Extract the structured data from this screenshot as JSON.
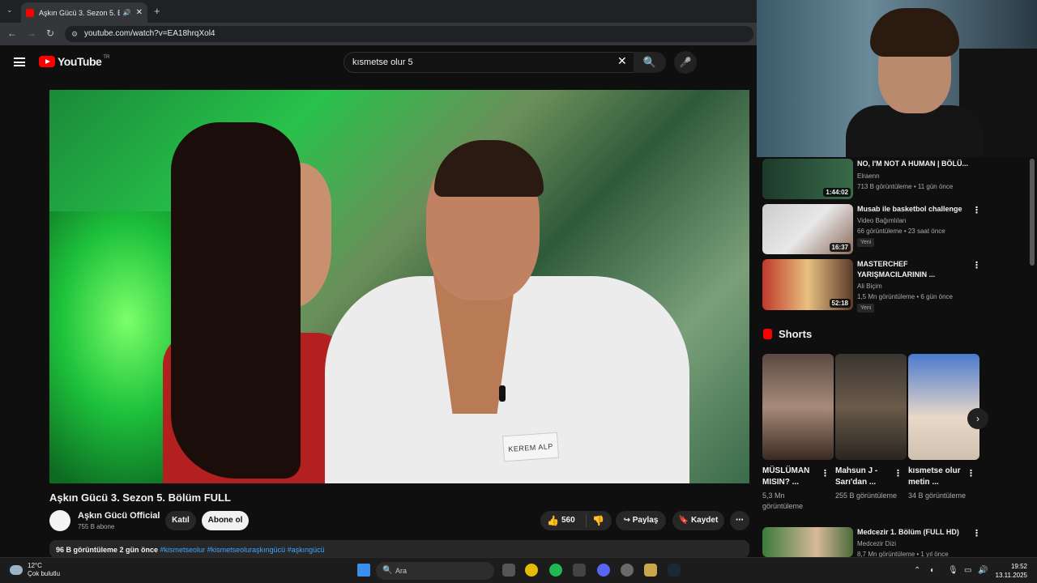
{
  "browser": {
    "tab_title": "Aşkın Gücü 3. Sezon 5. Bölü",
    "url": "youtube.com/watch?v=EA18hrqXol4"
  },
  "header": {
    "logo_word": "YouTube",
    "country_code": "TR",
    "search_value": "kısmetse olur 5"
  },
  "video": {
    "nametag": "KEREM ALP",
    "title": "Aşkın Gücü 3. Sezon 5. Bölüm FULL",
    "channel": "Aşkın Gücü Official",
    "subscribers": "755 B abone",
    "join_label": "Katıl",
    "subscribe_label": "Abone ol",
    "likes": "560",
    "share_label": "Paylaş",
    "save_label": "Kaydet",
    "views_date": "96 B görüntüleme  2 gün önce",
    "hashtags": "#kismetseolur #kismetseoluraşkıngücü #aşkıngücü"
  },
  "sidebar": {
    "items": [
      {
        "title": "NO, I'M NOT A HUMAN | BÖLÜ...",
        "channel": "Elraenn",
        "meta": "713 B görüntüleme • 11 gün önce",
        "duration": "1:44:02",
        "badge": ""
      },
      {
        "title": "Musab ile basketbol challenge",
        "channel": "Video Bağımlıları",
        "meta": "66 görüntüleme • 23 saat önce",
        "duration": "16:37",
        "badge": "Yeni"
      },
      {
        "title": "MASTERCHEF YARIŞMACILARININ ...",
        "channel": "Ali Biçim",
        "meta": "1,5 Mn görüntüleme • 6 gün önce",
        "duration": "52:18",
        "badge": "Yeni"
      },
      {
        "title": "Medcezir 1. Bölüm (FULL HD)",
        "channel": "Medcezir Dizi",
        "meta": "8,7 Mn görüntüleme • 1 yıl önce",
        "duration": "",
        "badge": ""
      }
    ],
    "shorts_header": "Shorts",
    "shorts": [
      {
        "title": "MÜSLÜMAN MISIN? ...",
        "views": "5,3 Mn görüntüleme"
      },
      {
        "title": "Mahsun J - Sarı'dan ...",
        "views": "255 B görüntüleme"
      },
      {
        "title": "kısmetse olur metin ...",
        "views": "34 B görüntüleme"
      }
    ]
  },
  "taskbar": {
    "temp": "12°C",
    "weather": "Çok bulutlu",
    "search_placeholder": "Ara",
    "time": "19:52",
    "date": "13.11.2025"
  }
}
